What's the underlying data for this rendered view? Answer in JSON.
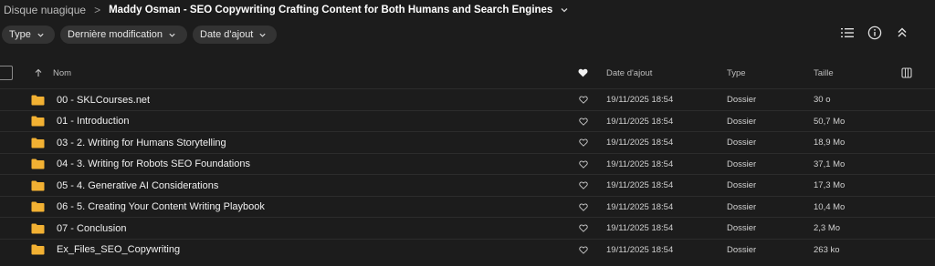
{
  "breadcrumb": {
    "root": "Disque nuagique",
    "separator": ">",
    "current": "Maddy Osman - SEO Copywriting Crafting Content for Both Humans and Search Engines"
  },
  "filters": [
    {
      "label": "Type"
    },
    {
      "label": "Dernière modification"
    },
    {
      "label": "Date d'ajout"
    }
  ],
  "toolbar": {
    "list_view_icon": "list-view-icon",
    "info_icon": "info-icon",
    "collapse_icon": "collapse-icon"
  },
  "columns": {
    "name": "Nom",
    "date": "Date d'ajout",
    "type": "Type",
    "size": "Taille"
  },
  "colors": {
    "background": "#1c1c1c",
    "chip": "#333333",
    "folder": "#f2b133"
  },
  "rows": [
    {
      "name": "00 - SKLCourses.net",
      "date": "19/11/2025 18:54",
      "type": "Dossier",
      "size": "30 o"
    },
    {
      "name": "01 - Introduction",
      "date": "19/11/2025 18:54",
      "type": "Dossier",
      "size": "50,7 Mo"
    },
    {
      "name": "03 - 2. Writing for Humans Storytelling",
      "date": "19/11/2025 18:54",
      "type": "Dossier",
      "size": "18,9 Mo"
    },
    {
      "name": "04 - 3. Writing for Robots SEO Foundations",
      "date": "19/11/2025 18:54",
      "type": "Dossier",
      "size": "37,1 Mo"
    },
    {
      "name": "05 - 4. Generative AI Considerations",
      "date": "19/11/2025 18:54",
      "type": "Dossier",
      "size": "17,3 Mo"
    },
    {
      "name": "06 - 5. Creating Your Content Writing Playbook",
      "date": "19/11/2025 18:54",
      "type": "Dossier",
      "size": "10,4 Mo"
    },
    {
      "name": "07 - Conclusion",
      "date": "19/11/2025 18:54",
      "type": "Dossier",
      "size": "2,3 Mo"
    },
    {
      "name": "Ex_Files_SEO_Copywriting",
      "date": "19/11/2025 18:54",
      "type": "Dossier",
      "size": "263 ko"
    }
  ]
}
